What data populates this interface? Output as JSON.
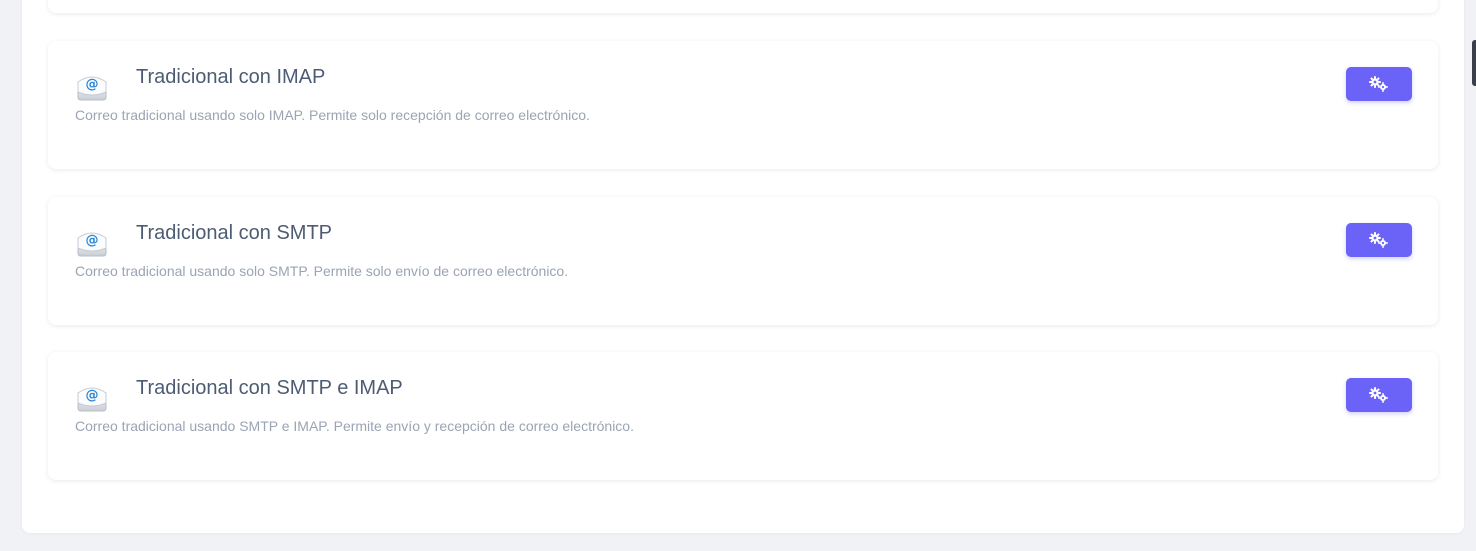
{
  "mail_options": [
    {
      "title": "Tradicional con IMAP",
      "description": "Correo tradicional usando solo IMAP. Permite solo recepción de correo electrónico.",
      "icon": "email-at-icon",
      "action_icon": "gears-icon"
    },
    {
      "title": "Tradicional con SMTP",
      "description": "Correo tradicional usando solo SMTP. Permite solo envío de correo electrónico.",
      "icon": "email-at-icon",
      "action_icon": "gears-icon"
    },
    {
      "title": "Tradicional con SMTP e IMAP",
      "description": "Correo tradicional usando SMTP e IMAP. Permite envío y recepción de correo electrónico.",
      "icon": "email-at-icon",
      "action_icon": "gears-icon"
    }
  ],
  "colors": {
    "page_background": "#f1f2f6",
    "card_background": "#ffffff",
    "title": "#4d5c73",
    "description": "#9aa4b3",
    "button": "#6b63f7"
  }
}
